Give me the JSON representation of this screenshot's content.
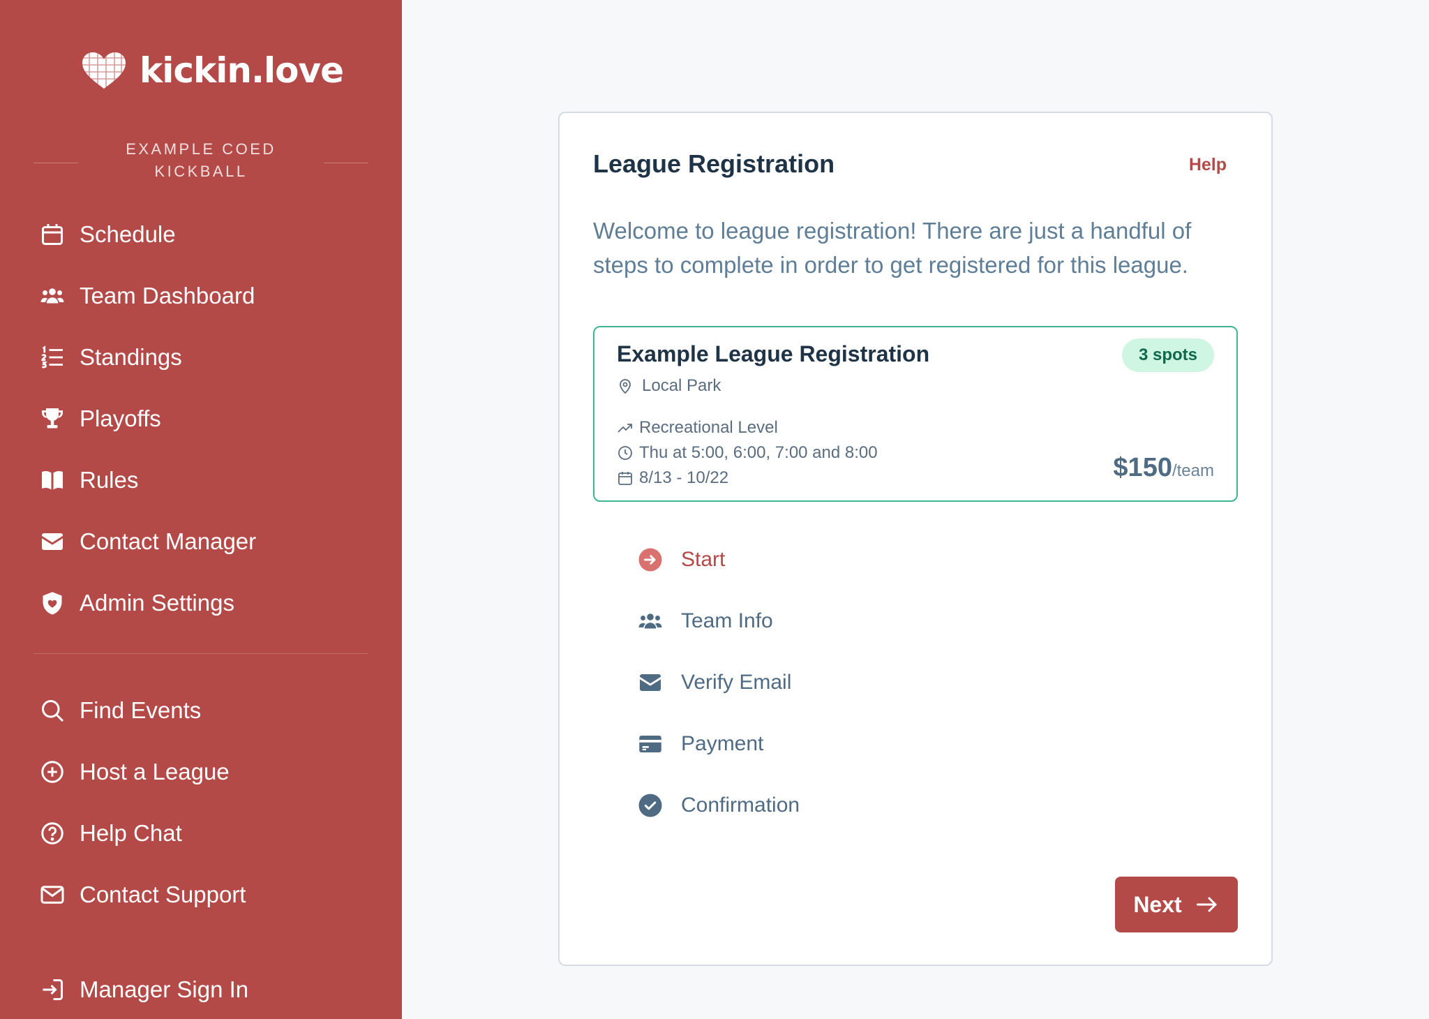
{
  "brand": {
    "name": "kickin.love",
    "logo_icon": "heart-weave-icon"
  },
  "org": {
    "name": "Example Coed Kickball"
  },
  "nav_primary": [
    {
      "label": "Schedule",
      "icon": "calendar-icon"
    },
    {
      "label": "Team Dashboard",
      "icon": "users-icon"
    },
    {
      "label": "Standings",
      "icon": "list-ordered-icon"
    },
    {
      "label": "Playoffs",
      "icon": "trophy-icon"
    },
    {
      "label": "Rules",
      "icon": "book-icon"
    },
    {
      "label": "Contact Manager",
      "icon": "envelope-icon"
    },
    {
      "label": "Admin Settings",
      "icon": "shield-heart-icon"
    }
  ],
  "nav_secondary": [
    {
      "label": "Find Events",
      "icon": "search-icon"
    },
    {
      "label": "Host a League",
      "icon": "plus-circle-icon"
    },
    {
      "label": "Help Chat",
      "icon": "question-circle-icon"
    },
    {
      "label": "Contact Support",
      "icon": "envelope-outline-icon"
    }
  ],
  "nav_footer": {
    "label": "Manager Sign In",
    "icon": "sign-in-icon"
  },
  "card": {
    "title": "League Registration",
    "help_label": "Help",
    "intro": "Welcome to league registration! There are just a handful of steps to complete in order to get registered for this league."
  },
  "league": {
    "name": "Example League Registration",
    "spots": "3 spots",
    "location": "Local Park",
    "level": "Recreational Level",
    "times": "Thu at 5:00, 6:00, 7:00 and 8:00",
    "dates": "8/13 - 10/22",
    "price": "$150",
    "price_unit": "/team"
  },
  "steps": [
    {
      "label": "Start",
      "icon": "arrow-circle-icon",
      "active": true
    },
    {
      "label": "Team Info",
      "icon": "users-icon",
      "active": false
    },
    {
      "label": "Verify Email",
      "icon": "envelope-icon",
      "active": false
    },
    {
      "label": "Payment",
      "icon": "credit-card-icon",
      "active": false
    },
    {
      "label": "Confirmation",
      "icon": "check-circle-icon",
      "active": false
    }
  ],
  "next_label": "Next",
  "colors": {
    "sidebar": "#b34a47",
    "accent": "#b34a47",
    "success_border": "#3fb58f",
    "badge_bg": "#cff5e3",
    "text_muted": "#5e7d97"
  }
}
